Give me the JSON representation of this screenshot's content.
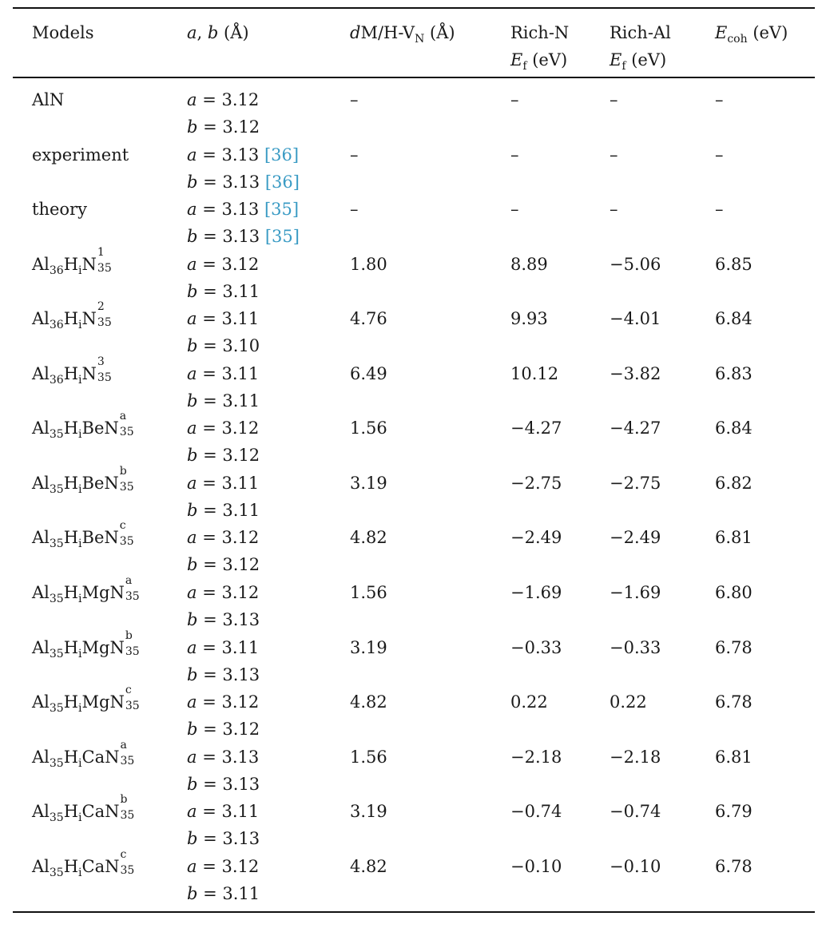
{
  "table": {
    "headers": {
      "models": "Models",
      "ab_italic_a": "a",
      "ab_sep": ", ",
      "ab_italic_b": "b",
      "ab_unit": " (Å)",
      "dist_italic": "d",
      "dist_main": "M/H-V",
      "dist_sub": "N",
      "dist_unit": " (Å)",
      "richN_line1": "Rich-N",
      "richN_E": "E",
      "richN_sub": "f",
      "richN_unit": " (eV)",
      "richAl_line1": "Rich-Al",
      "richAl_E": "E",
      "richAl_sub": "f",
      "richAl_unit": " (eV)",
      "ecoh_E": "E",
      "ecoh_sub": "coh",
      "ecoh_unit": " (eV)"
    },
    "rows": [
      {
        "model": {
          "plain": "AlN"
        },
        "a": "3.12",
        "b": "3.12",
        "a_cite": "",
        "b_cite": "",
        "d": "–",
        "richN": "–",
        "richAl": "–",
        "ecoh": "–"
      },
      {
        "model": {
          "plain": "experiment"
        },
        "a": "3.13",
        "b": "3.13",
        "a_cite": "[36]",
        "b_cite": "[36]",
        "d": "–",
        "richN": "–",
        "richAl": "–",
        "ecoh": "–"
      },
      {
        "model": {
          "plain": "theory"
        },
        "a": "3.13",
        "b": "3.13",
        "a_cite": "[35]",
        "b_cite": "[35]",
        "d": "–",
        "richN": "–",
        "richAl": "–",
        "ecoh": "–"
      },
      {
        "model": {
          "al": "Al",
          "al_sub": "36",
          "h": "H",
          "h_sub": "i",
          "dopant": "",
          "n": "N",
          "n_sup": "1",
          "n_sub": "35"
        },
        "a": "3.12",
        "b": "3.11",
        "a_cite": "",
        "b_cite": "",
        "d": "1.80",
        "richN": "8.89",
        "richAl": "−5.06",
        "ecoh": "6.85"
      },
      {
        "model": {
          "al": "Al",
          "al_sub": "36",
          "h": "H",
          "h_sub": "i",
          "dopant": "",
          "n": "N",
          "n_sup": "2",
          "n_sub": "35"
        },
        "a": "3.11",
        "b": "3.10",
        "a_cite": "",
        "b_cite": "",
        "d": "4.76",
        "richN": "9.93",
        "richAl": "−4.01",
        "ecoh": "6.84"
      },
      {
        "model": {
          "al": "Al",
          "al_sub": "36",
          "h": "H",
          "h_sub": "i",
          "dopant": "",
          "n": "N",
          "n_sup": "3",
          "n_sub": "35"
        },
        "a": "3.11",
        "b": "3.11",
        "a_cite": "",
        "b_cite": "",
        "d": "6.49",
        "richN": "10.12",
        "richAl": "−3.82",
        "ecoh": "6.83"
      },
      {
        "model": {
          "al": "Al",
          "al_sub": "35",
          "h": "H",
          "h_sub": "i",
          "dopant": "Be",
          "n": "N",
          "n_sup": "a",
          "n_sub": "35"
        },
        "a": "3.12",
        "b": "3.12",
        "a_cite": "",
        "b_cite": "",
        "d": "1.56",
        "richN": "−4.27",
        "richAl": "−4.27",
        "ecoh": "6.84"
      },
      {
        "model": {
          "al": "Al",
          "al_sub": "35",
          "h": "H",
          "h_sub": "i",
          "dopant": "Be",
          "n": "N",
          "n_sup": "b",
          "n_sub": "35"
        },
        "a": "3.11",
        "b": "3.11",
        "a_cite": "",
        "b_cite": "",
        "d": "3.19",
        "richN": "−2.75",
        "richAl": "−2.75",
        "ecoh": "6.82"
      },
      {
        "model": {
          "al": "Al",
          "al_sub": "35",
          "h": "H",
          "h_sub": "i",
          "dopant": "Be",
          "n": "N",
          "n_sup": "c",
          "n_sub": "35"
        },
        "a": "3.12",
        "b": "3.12",
        "a_cite": "",
        "b_cite": "",
        "d": "4.82",
        "richN": "−2.49",
        "richAl": "−2.49",
        "ecoh": "6.81"
      },
      {
        "model": {
          "al": "Al",
          "al_sub": "35",
          "h": "H",
          "h_sub": "i",
          "dopant": "Mg",
          "n": "N",
          "n_sup": "a",
          "n_sub": "35"
        },
        "a": "3.12",
        "b": "3.13",
        "a_cite": "",
        "b_cite": "",
        "d": "1.56",
        "richN": "−1.69",
        "richAl": "−1.69",
        "ecoh": "6.80"
      },
      {
        "model": {
          "al": "Al",
          "al_sub": "35",
          "h": "H",
          "h_sub": "i",
          "dopant": "Mg",
          "n": "N",
          "n_sup": "b",
          "n_sub": "35"
        },
        "a": "3.11",
        "b": "3.13",
        "a_cite": "",
        "b_cite": "",
        "d": "3.19",
        "richN": "−0.33",
        "richAl": "−0.33",
        "ecoh": "6.78"
      },
      {
        "model": {
          "al": "Al",
          "al_sub": "35",
          "h": "H",
          "h_sub": "i",
          "dopant": "Mg",
          "n": "N",
          "n_sup": "c",
          "n_sub": "35"
        },
        "a": "3.12",
        "b": "3.12",
        "a_cite": "",
        "b_cite": "",
        "d": "4.82",
        "richN": "0.22",
        "richAl": "0.22",
        "ecoh": "6.78"
      },
      {
        "model": {
          "al": "Al",
          "al_sub": "35",
          "h": "H",
          "h_sub": "i",
          "dopant": "Ca",
          "n": "N",
          "n_sup": "a",
          "n_sub": "35"
        },
        "a": "3.13",
        "b": "3.13",
        "a_cite": "",
        "b_cite": "",
        "d": "1.56",
        "richN": "−2.18",
        "richAl": "−2.18",
        "ecoh": "6.81"
      },
      {
        "model": {
          "al": "Al",
          "al_sub": "35",
          "h": "H",
          "h_sub": "i",
          "dopant": "Ca",
          "n": "N",
          "n_sup": "b",
          "n_sub": "35"
        },
        "a": "3.11",
        "b": "3.13",
        "a_cite": "",
        "b_cite": "",
        "d": "3.19",
        "richN": "−0.74",
        "richAl": "−0.74",
        "ecoh": "6.79"
      },
      {
        "model": {
          "al": "Al",
          "al_sub": "35",
          "h": "H",
          "h_sub": "i",
          "dopant": "Ca",
          "n": "N",
          "n_sup": "c",
          "n_sub": "35"
        },
        "a": "3.12",
        "b": "3.11",
        "a_cite": "",
        "b_cite": "",
        "d": "4.82",
        "richN": "−0.10",
        "richAl": "−0.10",
        "ecoh": "6.78"
      }
    ],
    "a_label": "a",
    "b_label": "b",
    "eq": " = ",
    "citation_color": "#3a9bc4"
  }
}
